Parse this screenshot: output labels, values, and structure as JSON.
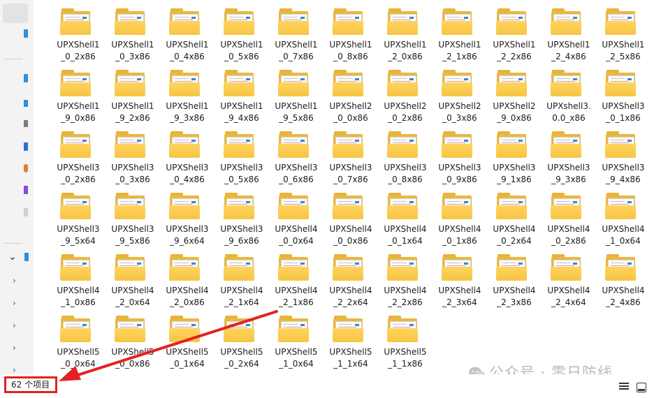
{
  "status_bar": {
    "item_count": "62 个项目"
  },
  "watermark": {
    "text": "公众号 · 零日防线"
  },
  "annotation_color": "#e32121",
  "folder_icon_name": "folder-icon",
  "files": [
    [
      "UPXShell1",
      "_0_2x86"
    ],
    [
      "UPXShell1",
      "_0_3x86"
    ],
    [
      "UPXShell1",
      "_0_4x86"
    ],
    [
      "UPXShell1",
      "_0_5x86"
    ],
    [
      "UPXShell1",
      "_0_7x86"
    ],
    [
      "UPXShell1",
      "_0_8x86"
    ],
    [
      "UPXShell1",
      "_2_0x86"
    ],
    [
      "UPXShell1",
      "_2_1x86"
    ],
    [
      "UPXShell1",
      "_2_2x86"
    ],
    [
      "UPXShell1",
      "_2_4x86"
    ],
    [
      "UPXShell1",
      "_2_5x86"
    ],
    [
      "UPXShell1",
      "_9_0x86"
    ],
    [
      "UPXShell1",
      "_9_2x86"
    ],
    [
      "UPXShell1",
      "_9_3x86"
    ],
    [
      "UPXShell1",
      "_9_4x86"
    ],
    [
      "UPXShell1",
      "_9_5x86"
    ],
    [
      "UPXShell2",
      "_0_0x86"
    ],
    [
      "UPXShell2",
      "_0_2x86"
    ],
    [
      "UPXShell2",
      "_0_3x86"
    ],
    [
      "UPXShell2",
      "_9_0x86"
    ],
    [
      "UPXshell3.",
      "0.0_x86"
    ],
    [
      "UPXShell3",
      "_0_1x86"
    ],
    [
      "UPXShell3",
      "_0_2x86"
    ],
    [
      "UPXShell3",
      "_0_3x86"
    ],
    [
      "UPXShell3",
      "_0_4x86"
    ],
    [
      "UPXShell3",
      "_0_5x86"
    ],
    [
      "UPXShell3",
      "_0_6x86"
    ],
    [
      "UPXShell3",
      "_0_7x86"
    ],
    [
      "UPXShell3",
      "_0_8x86"
    ],
    [
      "UPXShell3",
      "_0_9x86"
    ],
    [
      "UPXShell3",
      "_9_1x86"
    ],
    [
      "UPXShell3",
      "_9_3x86"
    ],
    [
      "UPXShell3",
      "_9_4x86"
    ],
    [
      "UPXShell3",
      "_9_5x64"
    ],
    [
      "UPXShell3",
      "_9_5x86"
    ],
    [
      "UPXShell3",
      "_9_6x64"
    ],
    [
      "UPXShell3",
      "_9_6x86"
    ],
    [
      "UPXShell4",
      "_0_0x64"
    ],
    [
      "UPXShell4",
      "_0_0x86"
    ],
    [
      "UPXShell4",
      "_0_1x64"
    ],
    [
      "UPXShell4",
      "_0_1x86"
    ],
    [
      "UPXShell4",
      "_0_2x64"
    ],
    [
      "UPXShell4",
      "_0_2x86"
    ],
    [
      "UPXShell4",
      "_1_0x64"
    ],
    [
      "UPXShell4",
      "_1_0x86"
    ],
    [
      "UPXShell4",
      "_2_0x64"
    ],
    [
      "UPXShell4",
      "_2_0x86"
    ],
    [
      "UPXShell4",
      "_2_1x64"
    ],
    [
      "UPXShell4",
      "_2_1x86"
    ],
    [
      "UPXShell4",
      "_2_2x64"
    ],
    [
      "UPXShell4",
      "_2_2x86"
    ],
    [
      "UPXShell4",
      "_2_3x64"
    ],
    [
      "UPXShell4",
      "_2_3x86"
    ],
    [
      "UPXShell4",
      "_2_4x64"
    ],
    [
      "UPXShell4",
      "_2_4x86"
    ],
    [
      "UPXShell5",
      "_0_0x64"
    ],
    [
      "UPXShell5",
      "_0_0x86"
    ],
    [
      "UPXShell5",
      "_0_1x64"
    ],
    [
      "UPXShell5",
      "_0_2x64"
    ],
    [
      "UPXShell5",
      "_1_0x64"
    ],
    [
      "UPXShell5",
      "_1_1x64"
    ],
    [
      "UPXShell5",
      "_1_1x86"
    ]
  ]
}
